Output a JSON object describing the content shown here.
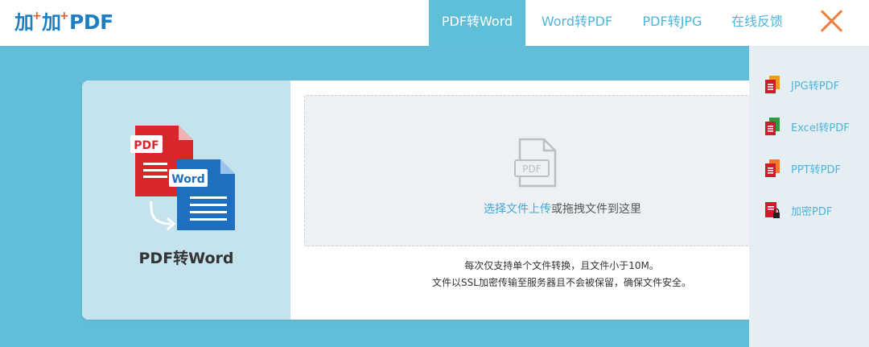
{
  "logo": {
    "text": "加加PDF"
  },
  "nav": {
    "items": [
      {
        "label": "PDF转Word",
        "active": true
      },
      {
        "label": "Word转PDF",
        "active": false
      },
      {
        "label": "PDF转JPG",
        "active": false
      },
      {
        "label": "在线反馈",
        "active": false
      }
    ],
    "close_icon": "close-icon"
  },
  "tool": {
    "title": "PDF转Word",
    "illustration": {
      "pdf_label": "PDF",
      "word_label": "Word"
    }
  },
  "dropzone": {
    "icon_label": "PDF",
    "link_text": "选择文件上传",
    "rest_text": "或拖拽文件到这里"
  },
  "notes": {
    "line1": "每次仅支持单个文件转换，且文件小于10M。",
    "line2": "文件以SSL加密传输至服务器且不会被保留，确保文件安全。"
  },
  "side_menu": {
    "items": [
      {
        "label": "JPG转PDF",
        "icon": "jpg-to-pdf-icon",
        "accent": "#f19a1e"
      },
      {
        "label": "Excel转PDF",
        "icon": "excel-to-pdf-icon",
        "accent": "#2e9b3e"
      },
      {
        "label": "PPT转PDF",
        "icon": "ppt-to-pdf-icon",
        "accent": "#ef7a2b"
      },
      {
        "label": "加密PDF",
        "icon": "encrypt-pdf-icon",
        "accent": "#d0192a"
      }
    ]
  },
  "colors": {
    "brand_blue": "#1e7fc0",
    "nav_text": "#4ab6dc",
    "nav_active_bg": "#5fbfd9",
    "page_bg": "#62bdd8",
    "pdf_red": "#d9252c",
    "word_blue": "#1f6fc0",
    "close_orange": "#ef7d3c"
  }
}
